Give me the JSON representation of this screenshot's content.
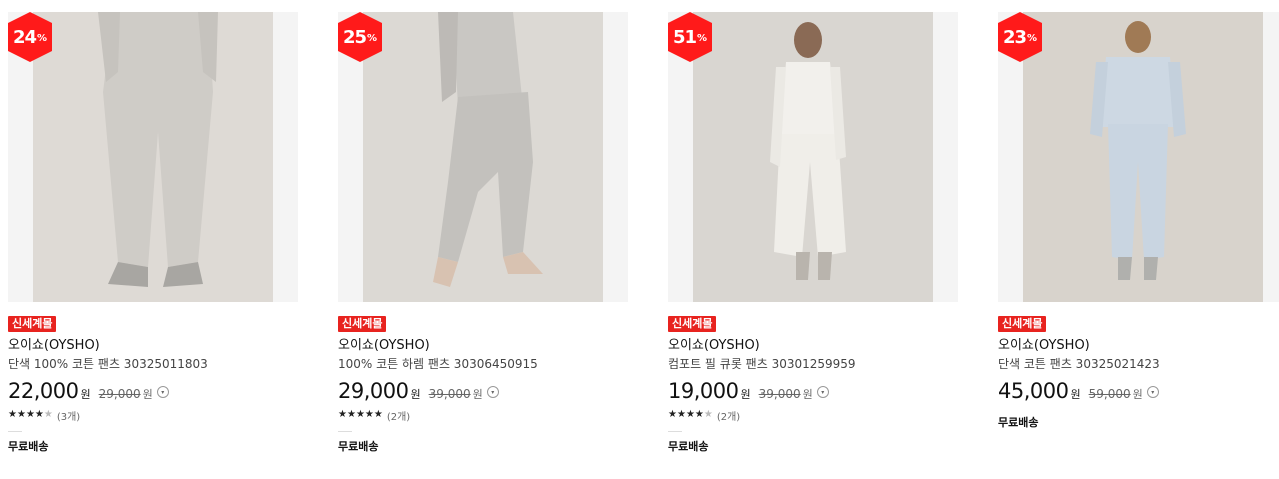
{
  "products": [
    {
      "discount": "24",
      "discount_unit": "%",
      "tag": "신세계몰",
      "brand": "오이쇼(OYSHO)",
      "name": "단색 100% 코튼 팬츠 30325011803",
      "price": "22,000",
      "currency": "원",
      "original_price": "29,000",
      "rating_stars": 4.5,
      "review_count": "(3개)",
      "shipping": "무료배송",
      "image_bg": "#f2f1ef",
      "garment_color": "#d4d1cd"
    },
    {
      "discount": "25",
      "discount_unit": "%",
      "tag": "신세계몰",
      "brand": "오이쇼(OYSHO)",
      "name": "100% 코튼 하렘 팬츠 30306450915",
      "price": "29,000",
      "currency": "원",
      "original_price": "39,000",
      "rating_stars": 5,
      "review_count": "(2개)",
      "shipping": "무료배송",
      "image_bg": "#eeedeb",
      "garment_color": "#c9c7c3"
    },
    {
      "discount": "51",
      "discount_unit": "%",
      "tag": "신세계몰",
      "brand": "오이쇼(OYSHO)",
      "name": "컴포트 필 큐롯 팬츠 30301259959",
      "price": "19,000",
      "currency": "원",
      "original_price": "39,000",
      "rating_stars": 4,
      "review_count": "(2개)",
      "shipping": "무료배송",
      "image_bg": "#eceae6",
      "garment_color": "#f5f3ef"
    },
    {
      "discount": "23",
      "discount_unit": "%",
      "tag": "신세계몰",
      "brand": "오이쇼(OYSHO)",
      "name": "단색 코튼 팬츠 30325021423",
      "price": "45,000",
      "currency": "원",
      "original_price": "59,000",
      "rating_stars": null,
      "review_count": "",
      "shipping": "무료배송",
      "image_bg": "#ebe8e3",
      "garment_color": "#cdd8e3"
    }
  ]
}
